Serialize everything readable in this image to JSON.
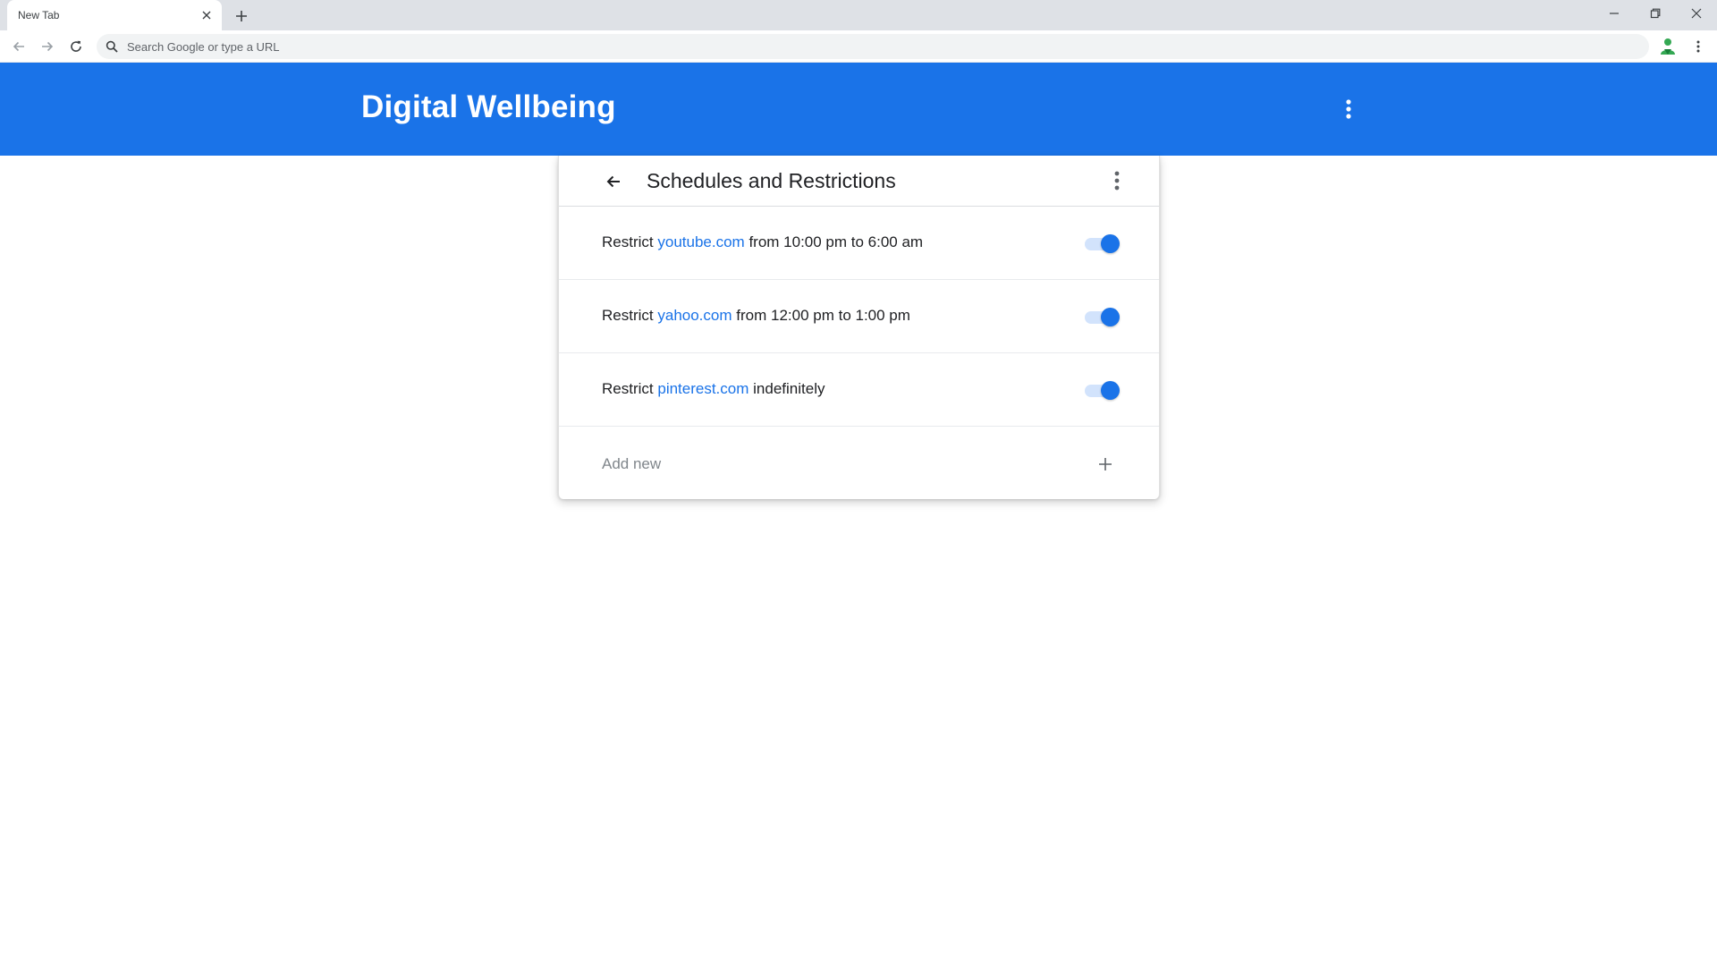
{
  "browser": {
    "tab_title": "New Tab",
    "omnibox_placeholder": "Search Google or type a URL",
    "omnibox_value": ""
  },
  "app": {
    "title": "Digital Wellbeing"
  },
  "page": {
    "title": "Schedules and Restrictions",
    "restrictions": [
      {
        "prefix": "Restrict",
        "site": "youtube.com",
        "suffix": "from 10:00 pm to 6:00 am",
        "enabled": true
      },
      {
        "prefix": "Restrict",
        "site": "yahoo.com",
        "suffix": "from 12:00 pm to 1:00 pm",
        "enabled": true
      },
      {
        "prefix": "Restrict",
        "site": "pinterest.com",
        "suffix": "indefinitely",
        "enabled": true
      }
    ],
    "add_new_label": "Add new"
  },
  "icons": {
    "tab_close": "close-icon",
    "new_tab": "plus-icon",
    "minimize": "minimize-icon",
    "restore": "restore-icon",
    "close_window": "close-icon",
    "back": "arrow-left-icon",
    "forward": "arrow-right-icon",
    "reload": "reload-icon",
    "search": "search-icon",
    "extension": "profile-icon",
    "menu": "more-vert-icon",
    "add": "plus-icon"
  },
  "colors": {
    "brand_blue": "#1a73e8",
    "toggle_track": "#d2e3fc",
    "tabstrip": "#dee1e6",
    "omnibox": "#f1f3f4",
    "extension_green": "#34a853"
  }
}
